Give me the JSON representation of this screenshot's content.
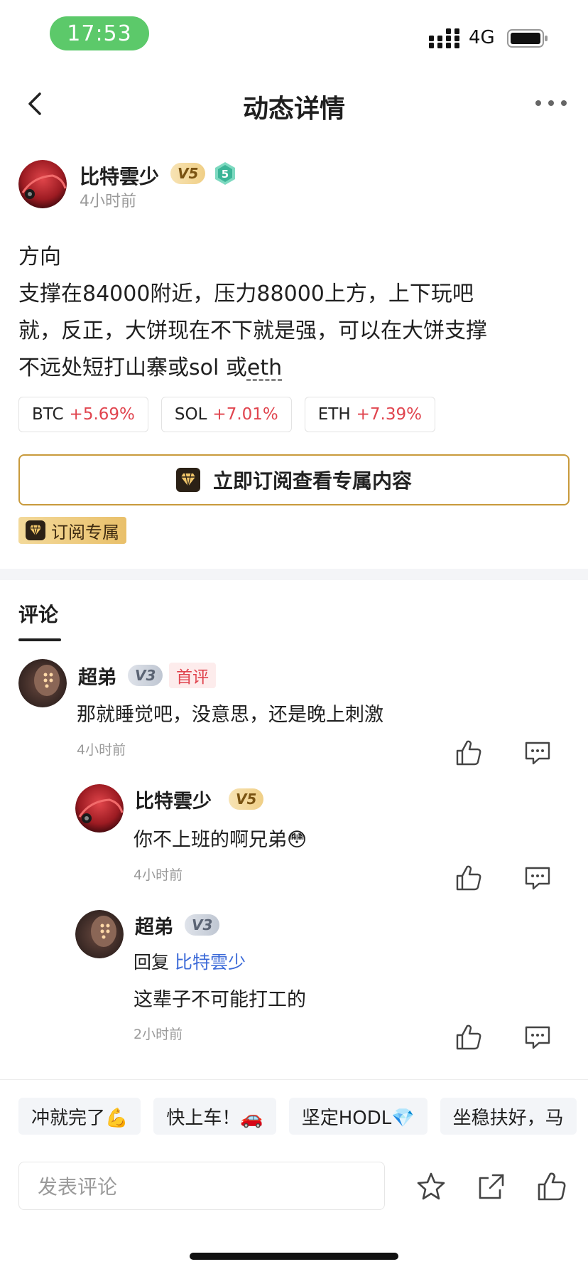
{
  "status_bar": {
    "time": "17:53",
    "network": "4G"
  },
  "nav": {
    "title": "动态详情"
  },
  "author": {
    "name": "比特雲少",
    "vip": "V5",
    "level": "5",
    "time": "4小时前"
  },
  "post": {
    "lines": [
      "方向",
      "支撑在84000附近，压力88000上方，上下玩吧",
      "就，反正，大饼现在不下就是强，可以在大饼支撑",
      "不远处短打山寨或sol 或"
    ],
    "last_link": "eth"
  },
  "tags": [
    {
      "symbol": "BTC",
      "change": "+5.69%"
    },
    {
      "symbol": "SOL",
      "change": "+7.01%"
    },
    {
      "symbol": "ETH",
      "change": "+7.39%"
    }
  ],
  "subscribe_button": "立即订阅查看专属内容",
  "subscribe_label": "订阅专属",
  "comments_tab": "评论",
  "comments": [
    {
      "name": "超弟",
      "vip": "V3",
      "first_badge": "首评",
      "text": "那就睡觉吧，没意思，还是晚上刺激",
      "time": "4小时前"
    },
    {
      "name": "比特雲少",
      "vip": "V5",
      "text": "你不上班的啊兄弟😳",
      "time": "4小时前"
    },
    {
      "name": "超弟",
      "vip": "V3",
      "reply_prefix": "回复",
      "reply_to": "比特雲少",
      "text": "这辈子不可能打工的",
      "time": "2小时前"
    }
  ],
  "quick_replies": [
    "冲就完了💪",
    "快上车！🚗",
    "坚定HODL💎",
    "坐稳扶好，马"
  ],
  "input": {
    "placeholder": "发表评论"
  },
  "colors": {
    "up": "#e0444e",
    "gold": "#c89a3c",
    "link": "#3d6bd8",
    "status_pill": "#5cc96a"
  }
}
